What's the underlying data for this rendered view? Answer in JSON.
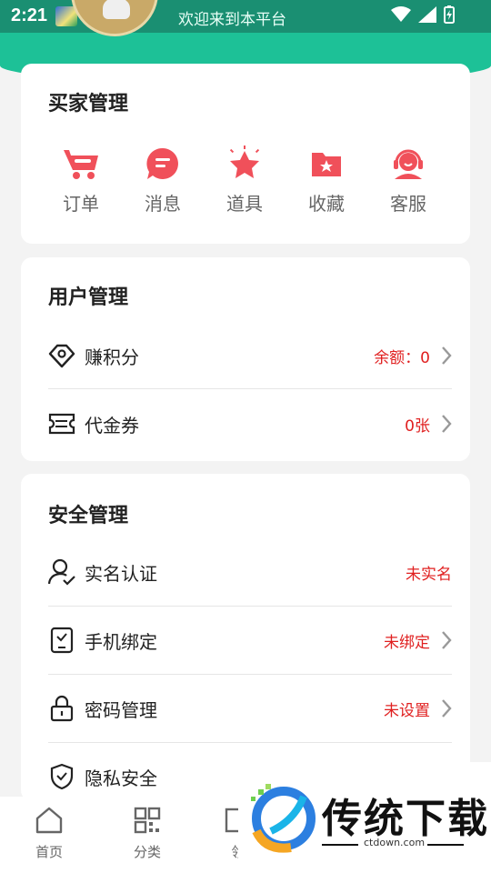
{
  "statusbar": {
    "time": "2:21",
    "title": "欢迎来到本平台"
  },
  "buyer": {
    "title": "买家管理",
    "tools": [
      {
        "label": "订单",
        "icon": "cart-icon"
      },
      {
        "label": "消息",
        "icon": "message-icon"
      },
      {
        "label": "道具",
        "icon": "star-icon"
      },
      {
        "label": "收藏",
        "icon": "folder-star-icon"
      },
      {
        "label": "客服",
        "icon": "headset-icon"
      }
    ]
  },
  "user": {
    "title": "用户管理",
    "rows": [
      {
        "label": "赚积分",
        "value": "余额：0",
        "icon": "diamond-icon"
      },
      {
        "label": "代金券",
        "value": "0张",
        "icon": "ticket-icon"
      }
    ]
  },
  "security": {
    "title": "安全管理",
    "rows": [
      {
        "label": "实名认证",
        "value": "未实名",
        "icon": "user-check-icon"
      },
      {
        "label": "手机绑定",
        "value": "未绑定",
        "icon": "phone-check-icon"
      },
      {
        "label": "密码管理",
        "value": "未设置",
        "icon": "lock-icon"
      },
      {
        "label": "隐私安全",
        "value": "",
        "icon": "shield-check-icon"
      }
    ]
  },
  "tabbar": {
    "tabs": [
      {
        "label": "首页",
        "icon": "home-icon"
      },
      {
        "label": "分类",
        "icon": "grid-icon"
      },
      {
        "label": "领",
        "icon": "coupon-icon"
      }
    ]
  },
  "watermark": {
    "text": "传统下载",
    "url": "ctdown.com"
  },
  "colors": {
    "brand": "#1dc197",
    "accent_red": "#f0505a",
    "value_red": "#e02020"
  }
}
